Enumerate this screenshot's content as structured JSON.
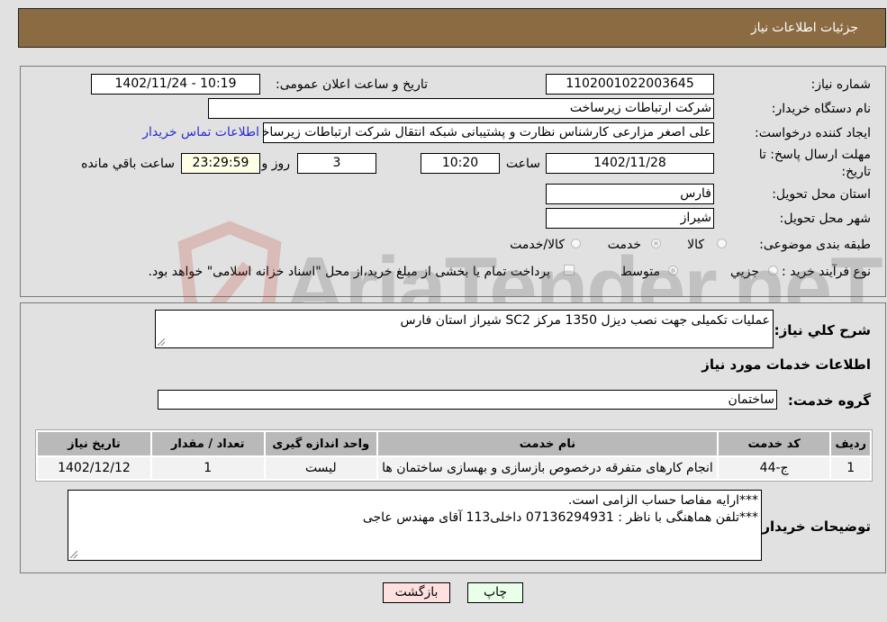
{
  "header": {
    "title": "جزئیات اطلاعات نیاز"
  },
  "form": {
    "need_number": {
      "label": "شماره نیاز:",
      "value": "1102001022003645"
    },
    "announce": {
      "label": "تاریخ و ساعت اعلان عمومی:",
      "value": "1402/11/24 - 10:19"
    },
    "buyer_org": {
      "label": "نام دستگاه خریدار:",
      "value": "شرکت ارتباطات زیرساخت"
    },
    "requester": {
      "label": "ایجاد کننده درخواست:",
      "value": "علی اصغر مزارعی کارشناس نظارت و پشتیبانی شبکه انتقال شرکت ارتباطات زیرساخت",
      "contact_link": "اطلاعات تماس خریدار"
    },
    "deadline": {
      "label_line1": "مهلت ارسال پاسخ: تا",
      "label_line2": "تاریخ:",
      "date": "1402/11/28",
      "time_label": "ساعت",
      "time": "10:20",
      "days": "3",
      "days_label": "روز و",
      "remaining": "23:29:59",
      "remaining_label": "ساعت باقي مانده"
    },
    "province": {
      "label": "استان محل تحویل:",
      "value": "فارس"
    },
    "city": {
      "label": "شهر محل تحویل:",
      "value": "شیراز"
    },
    "category": {
      "label": "طبقه بندی موضوعی:",
      "options": [
        {
          "label": "کالا",
          "checked": false
        },
        {
          "label": "خدمت",
          "checked": true
        },
        {
          "label": "کالا/خدمت",
          "checked": false
        }
      ]
    },
    "purchase_type": {
      "label": "نوع فرآیند خرید :",
      "options": [
        {
          "label": "جزيي",
          "checked": false
        },
        {
          "label": "متوسط",
          "checked": true
        }
      ],
      "treasury_checkbox_label": "پرداخت تمام یا بخشی از مبلغ خرید،از محل \"اسناد خزانه اسلامی\" خواهد بود.",
      "treasury_checked": false
    }
  },
  "details": {
    "description_label": "شرح کلي نیاز:",
    "description": "عملیات تکمیلی جهت نصب دیزل 1350 مرکز SC2 شیراز استان فارس",
    "services_heading": "اطلاعات خدمات مورد نیاز",
    "service_group_label": "گروه خدمت:",
    "service_group": "ساختمان",
    "table": {
      "headers": [
        "ردیف",
        "کد خدمت",
        "نام خدمت",
        "واحد اندازه گیری",
        "تعداد / مقدار",
        "تاریخ نیاز"
      ],
      "rows": [
        [
          "1",
          "ج-44",
          "انجام کارهای متفرقه درخصوص بازسازی و بهسازی ساختمان ها",
          "لیست",
          "1",
          "1402/12/12"
        ]
      ]
    },
    "buyer_notes_label": "توضیحات خریدار:",
    "buyer_notes_line1": "***ارایه مفاصا حساب الزامی است.",
    "buyer_notes_line2": "***تلفن هماهنگی با ناظر : 07136294931 داخلی113 آقای مهندس عاجی"
  },
  "buttons": {
    "print": "چاپ",
    "back": "بازگشت"
  },
  "watermark": {
    "text": "AriaTender.neT"
  },
  "colors": {
    "header_bg": "#8b6b42",
    "print_bg": "#eaffea",
    "back_bg": "#ffe0e0",
    "link": "#2a2ad0"
  }
}
